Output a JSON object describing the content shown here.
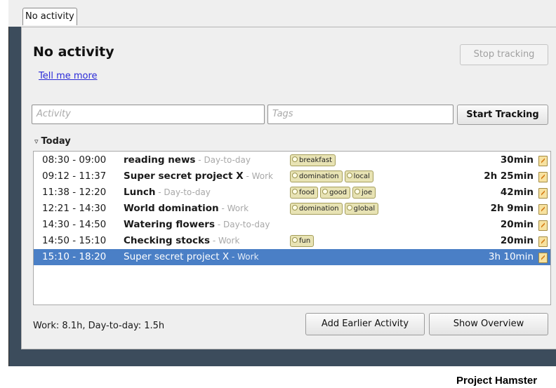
{
  "tab": {
    "label": "No activity"
  },
  "header": {
    "title": "No activity",
    "link": "Tell me more",
    "stop_label": "Stop tracking"
  },
  "inputs": {
    "activity_placeholder": "Activity",
    "tags_placeholder": "Tags",
    "start_label": "Start Tracking"
  },
  "section": {
    "label": "Today"
  },
  "activities": [
    {
      "time": "08:30 - 09:00",
      "name": "reading news",
      "category": "Day-to-day",
      "tags": [
        "breakfast"
      ],
      "duration": "30min"
    },
    {
      "time": "09:12 - 11:37",
      "name": "Super secret project X",
      "category": "Work",
      "tags": [
        "domination",
        "local"
      ],
      "duration": "2h 25min"
    },
    {
      "time": "11:38 - 12:20",
      "name": "Lunch",
      "category": "Day-to-day",
      "tags": [
        "food",
        "good",
        "joe"
      ],
      "duration": "42min"
    },
    {
      "time": "12:21 - 14:30",
      "name": "World domination",
      "category": "Work",
      "tags": [
        "domination",
        "global"
      ],
      "duration": "2h 9min"
    },
    {
      "time": "14:30 - 14:50",
      "name": "Watering flowers",
      "category": "Day-to-day",
      "tags": [],
      "duration": "20min"
    },
    {
      "time": "14:50 - 15:10",
      "name": "Checking stocks",
      "category": "Work",
      "tags": [
        "fun"
      ],
      "duration": "20min"
    },
    {
      "time": "15:10 - 18:20",
      "name": "Super secret project X",
      "category": "Work",
      "tags": [],
      "duration": "3h 10min",
      "selected": true
    }
  ],
  "footer": {
    "summary": "Work: 8.1h, Day-to-day: 1.5h",
    "earlier_label": "Add Earlier Activity",
    "overview_label": "Show Overview"
  },
  "caption": "Project Hamster",
  "colors": {
    "selection": "#4a7fc6",
    "link": "#2b2bd8",
    "tag_bg": "#e8e3b4",
    "frame": "#3c4c5c"
  }
}
